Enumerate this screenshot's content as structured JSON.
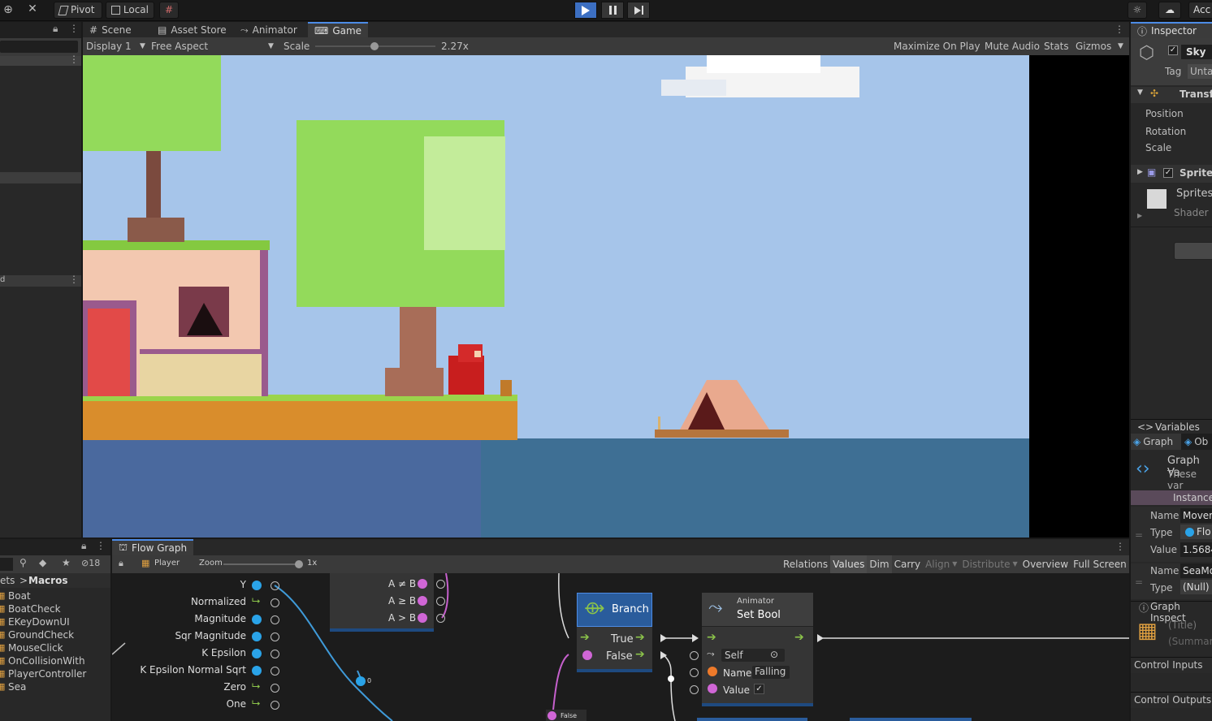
{
  "toolbar": {
    "pivot": "Pivot",
    "local": "Local",
    "account": "Acc"
  },
  "editor_tabs": [
    "Scene",
    "Asset Store",
    "Animator",
    "Game"
  ],
  "game_controls": {
    "display": "Display 1",
    "aspect": "Free Aspect",
    "scale_label": "Scale",
    "scale_value": "2.27x",
    "maximize": "Maximize On Play",
    "mute": "Mute Audio",
    "stats": "Stats",
    "gizmos": "Gizmos",
    "scale_fraction": 0.49
  },
  "left_panel": {
    "marker": "d"
  },
  "inspector": {
    "tab": "Inspector",
    "object_name": "Sky",
    "tag_label": "Tag",
    "tag_value": "Untag",
    "transform_title": "Transf",
    "transform_rows": [
      "Position",
      "Rotation",
      "Scale"
    ],
    "sprite_title": "Sprite",
    "sprite_material": "Sprites",
    "sprite_shader": "Shader",
    "variables_title": "Variables",
    "graph_tab": "Graph",
    "obj_tab": "Ob",
    "graph_vars_title": "Graph Va",
    "graph_vars_desc": "These var",
    "instance": "Instance",
    "var1": {
      "name_label": "Name",
      "name_value": "Mover",
      "type_label": "Type",
      "type_value": "Flo",
      "value_label": "Value",
      "value_value": "1.5684"
    },
    "var2": {
      "name_label": "Name",
      "name_value": "SeaMo",
      "type_label": "Type",
      "type_value": "(Null)"
    },
    "graph_inspector": "Graph Inspect",
    "title_placeholder": "(Title)",
    "summary_placeholder": "(Summary",
    "control_inputs": "Control Inputs",
    "control_outputs": "Control Outputs"
  },
  "project": {
    "count": "18",
    "breadcrumb_parent": "ets",
    "breadcrumb_sep": ">",
    "breadcrumb_current": "Macros",
    "items": [
      "Boat",
      "BoatCheck",
      "EKeyDownUI",
      "GroundCheck",
      "MouseClick",
      "OnCollisionWith",
      "PlayerController",
      "Sea"
    ]
  },
  "flow_graph": {
    "tab": "Flow Graph",
    "graph_name": "Player",
    "zoom_label": "Zoom",
    "zoom_value": "1x",
    "toolbar_buttons": [
      "Relations",
      "Values",
      "Dim",
      "Carry",
      "Align",
      "Distribute",
      "Overview",
      "Full Screen"
    ],
    "vector_ports": [
      "Y",
      "Normalized",
      "Magnitude",
      "Sqr Magnitude",
      "K Epsilon",
      "K Epsilon Normal Sqrt",
      "Zero",
      "One"
    ],
    "compare_ports": [
      "A ≠ B",
      "A ≥ B",
      "A > B"
    ],
    "branch": {
      "title": "Branch",
      "true_label": "True",
      "false_label": "False"
    },
    "set_bool": {
      "subtitle": "Animator",
      "title": "Set Bool",
      "self_label": "Self",
      "name_label": "Name",
      "name_value": "Falling",
      "value_label": "Value"
    },
    "literal_false": "False",
    "literal_zero": "0"
  },
  "colors": {
    "accent": "#4d8ce6",
    "float_port": "#2aa3e8",
    "bool_port": "#d066d6",
    "string_port": "#ee7a2a",
    "flow_arrow": "#8bc34a",
    "sky": "#a6c5ea",
    "sea": "#3e6f94"
  }
}
